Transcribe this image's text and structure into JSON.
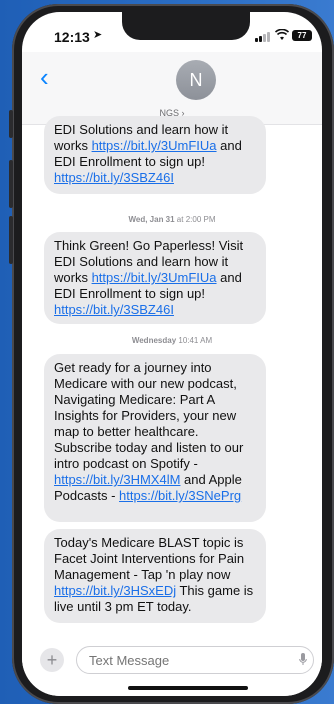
{
  "status": {
    "time": "12:13",
    "battery": "77"
  },
  "header": {
    "avatar_initial": "N",
    "contact_name": "NGS ›"
  },
  "messages": [
    {
      "type": "bubble",
      "top": 0,
      "parts": [
        {
          "t": "EDI Solutions and learn how it works "
        },
        {
          "t": "https://bit.ly/3UmFIUa",
          "link": true
        },
        {
          "t": " and EDI Enrollment to sign up! "
        },
        {
          "t": "https://bit.ly/3SBZ46I",
          "link": true
        }
      ]
    },
    {
      "type": "timestamp",
      "day": "Wed, Jan 31",
      "time": "at 2:00 PM"
    },
    {
      "type": "bubble",
      "parts": [
        {
          "t": "Think Green! Go Paperless! Visit EDI Solutions and learn how it works "
        },
        {
          "t": "https://bit.ly/3UmFIUa",
          "link": true
        },
        {
          "t": " and EDI Enrollment to sign up! "
        },
        {
          "t": "https://bit.ly/3SBZ46I",
          "link": true
        }
      ]
    },
    {
      "type": "timestamp",
      "day": "Wednesday",
      "time": "10:41 AM"
    },
    {
      "type": "bubble",
      "parts": [
        {
          "t": "Get ready for a journey into Medicare with our new podcast, Navigating Medicare: Part A Insights for Providers, your new map to better healthcare. Subscribe today and listen to our intro podcast on Spotify - "
        },
        {
          "t": "https://bit.ly/3HMX4lM",
          "link": true
        },
        {
          "t": " and Apple Podcasts - "
        },
        {
          "t": "https://bit.ly/3SNePrg",
          "link": true
        }
      ]
    },
    {
      "type": "bubble",
      "parts": [
        {
          "t": "Today's Medicare BLAST topic is Facet Joint Interventions for Pain Management - Tap 'n play now "
        },
        {
          "t": "https://bit.ly/3HSxEDj",
          "link": true
        },
        {
          "t": " This game is live until 3 pm ET today."
        }
      ]
    }
  ],
  "input": {
    "placeholder": "Text Message"
  }
}
